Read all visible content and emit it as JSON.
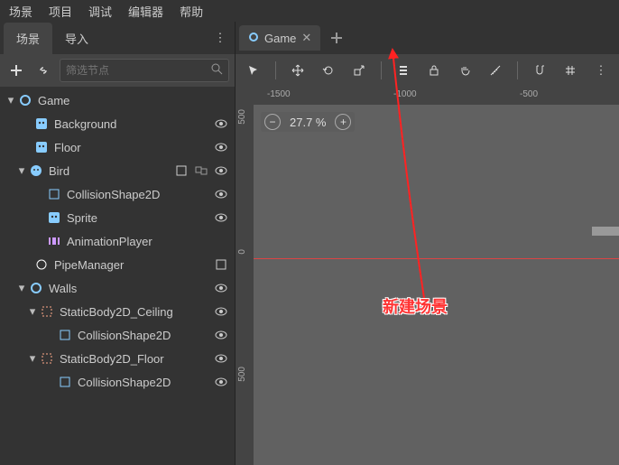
{
  "menu": {
    "scene": "场景",
    "project": "项目",
    "debug": "调试",
    "editor": "编辑器",
    "help": "帮助"
  },
  "ltabs": {
    "scene": "场景",
    "import": "导入"
  },
  "search": {
    "placeholder": "筛选节点"
  },
  "tree": {
    "root": "Game",
    "bg": "Background",
    "floor": "Floor",
    "bird": "Bird",
    "coll": "CollisionShape2D",
    "sprite": "Sprite",
    "anim": "AnimationPlayer",
    "pipemgr": "PipeManager",
    "walls": "Walls",
    "ceil": "StaticBody2D_Ceiling",
    "sbfloor": "StaticBody2D_Floor"
  },
  "rtab": {
    "label": "Game"
  },
  "zoom": {
    "level": "27.7 %"
  },
  "ruler": {
    "h1": "-1500",
    "h2": "-1000",
    "h3": "-500",
    "v1": "500",
    "v2": "0",
    "v3": "500"
  },
  "annotation": {
    "label": "新建场景"
  }
}
